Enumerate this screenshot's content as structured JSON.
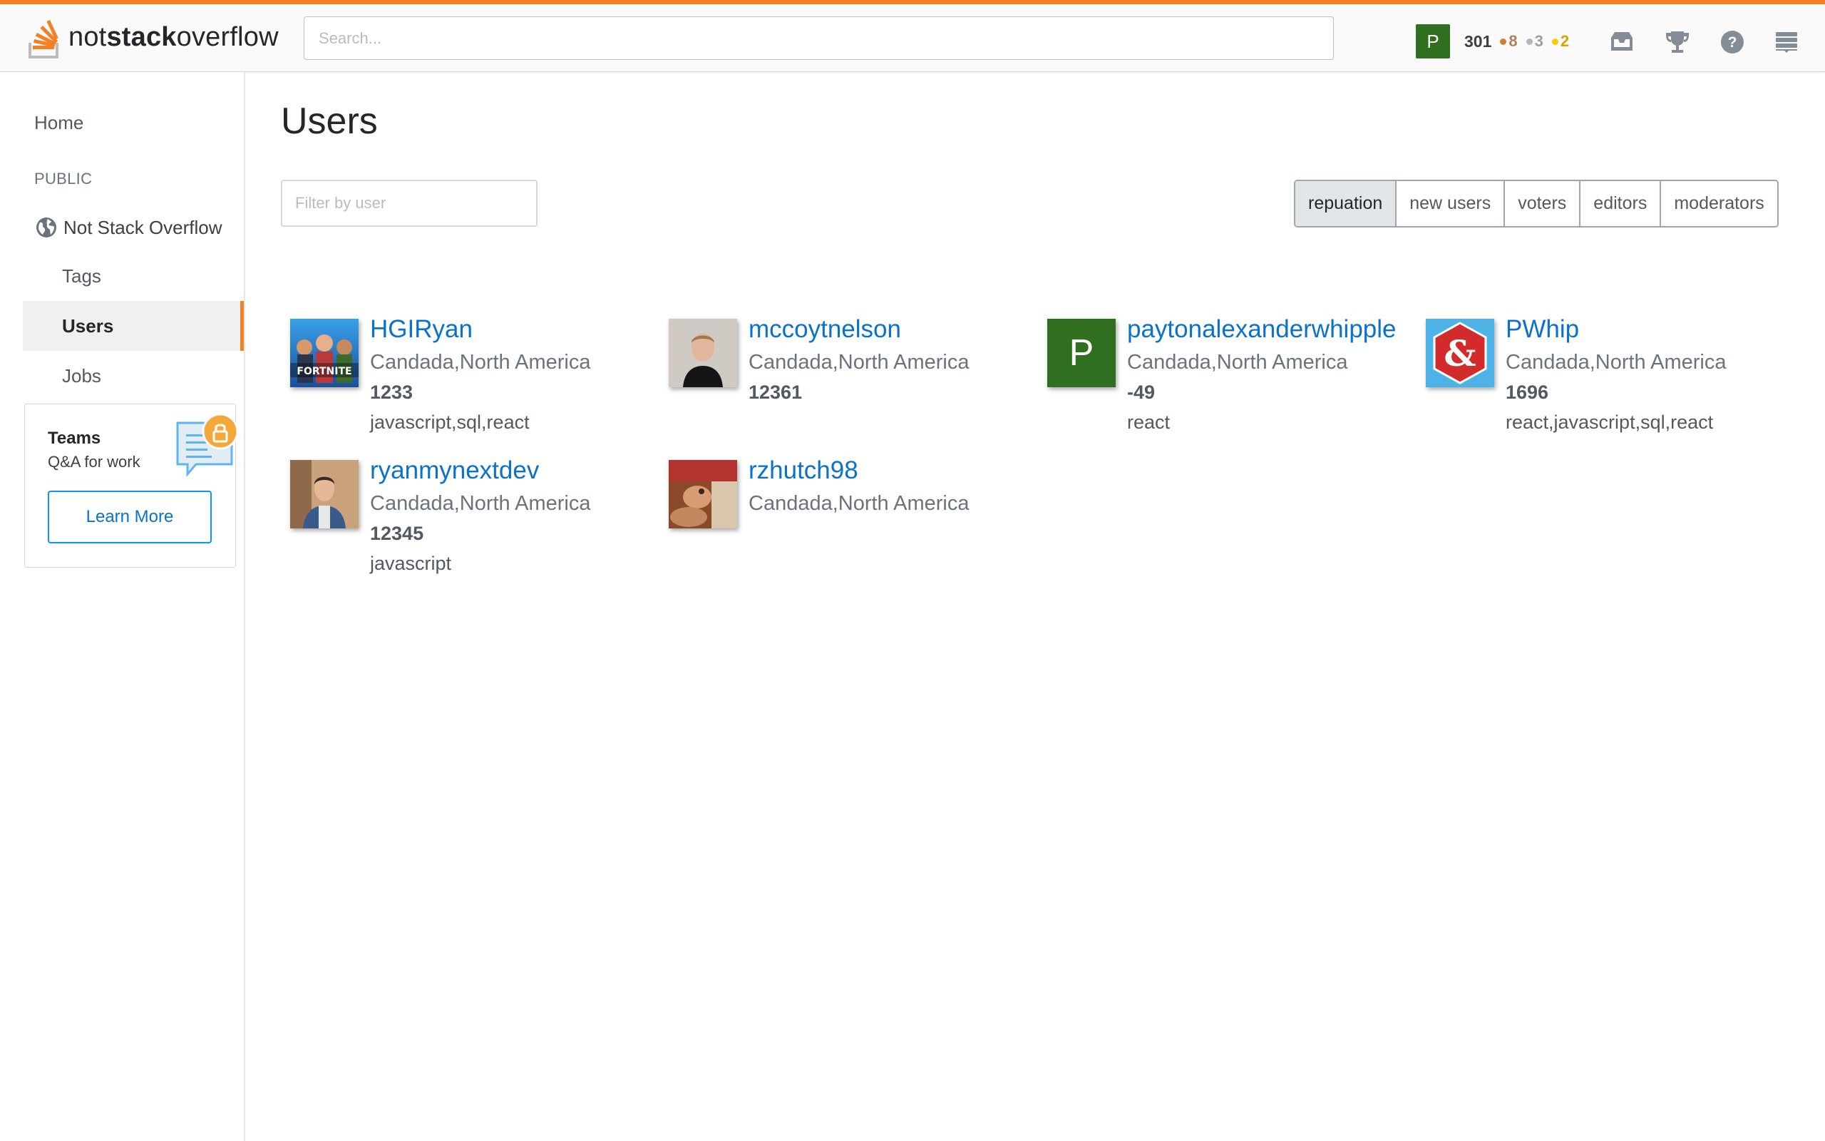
{
  "header": {
    "logo_text_plain": "not",
    "logo_text_bold": "stack",
    "logo_text_tail": "overflow",
    "search_placeholder": "Search...",
    "user_initial": "P",
    "reputation": "301",
    "badges": {
      "bronze": "8",
      "silver": "3",
      "gold": "2"
    },
    "icons": [
      "inbox-icon",
      "achievements-icon",
      "help-icon",
      "site-switcher-icon"
    ]
  },
  "sidebar": {
    "home": "Home",
    "public_heading": "PUBLIC",
    "site_name": "Not Stack Overflow",
    "items": [
      {
        "label": "Tags"
      },
      {
        "label": "Users"
      },
      {
        "label": "Jobs"
      }
    ],
    "teams": {
      "title": "Teams",
      "subtitle": "Q&A for work",
      "button": "Learn More"
    }
  },
  "main": {
    "title": "Users",
    "filter_placeholder": "Filter by user",
    "tabs": [
      "repuation",
      "new users",
      "voters",
      "editors",
      "moderators"
    ],
    "active_tab": "repuation",
    "users": [
      {
        "name": "HGIRyan",
        "location": "Candada,North America",
        "reputation": "1233",
        "tags": "javascript,sql,react",
        "avatar_text": "FORTNITE"
      },
      {
        "name": "mccoytnelson",
        "location": "Candada,North America",
        "reputation": "12361",
        "tags": ""
      },
      {
        "name": "paytonalexanderwhipple",
        "location": "Candada,North America",
        "reputation": "-49",
        "tags": "react",
        "avatar_initial": "P"
      },
      {
        "name": "PWhip",
        "location": "Candada,North America",
        "reputation": "1696",
        "tags": "react,javascript,sql,react",
        "avatar_text": "&"
      },
      {
        "name": "ryanmynextdev",
        "location": "Candada,North America",
        "reputation": "12345",
        "tags": "javascript"
      },
      {
        "name": "rzhutch98",
        "location": "Candada,North America",
        "reputation": "",
        "tags": ""
      }
    ]
  },
  "colors": {
    "accent": "#f48024",
    "link": "#0a72c9",
    "avatar_green": "#2f6f1f",
    "button_border": "#0a95ff"
  }
}
